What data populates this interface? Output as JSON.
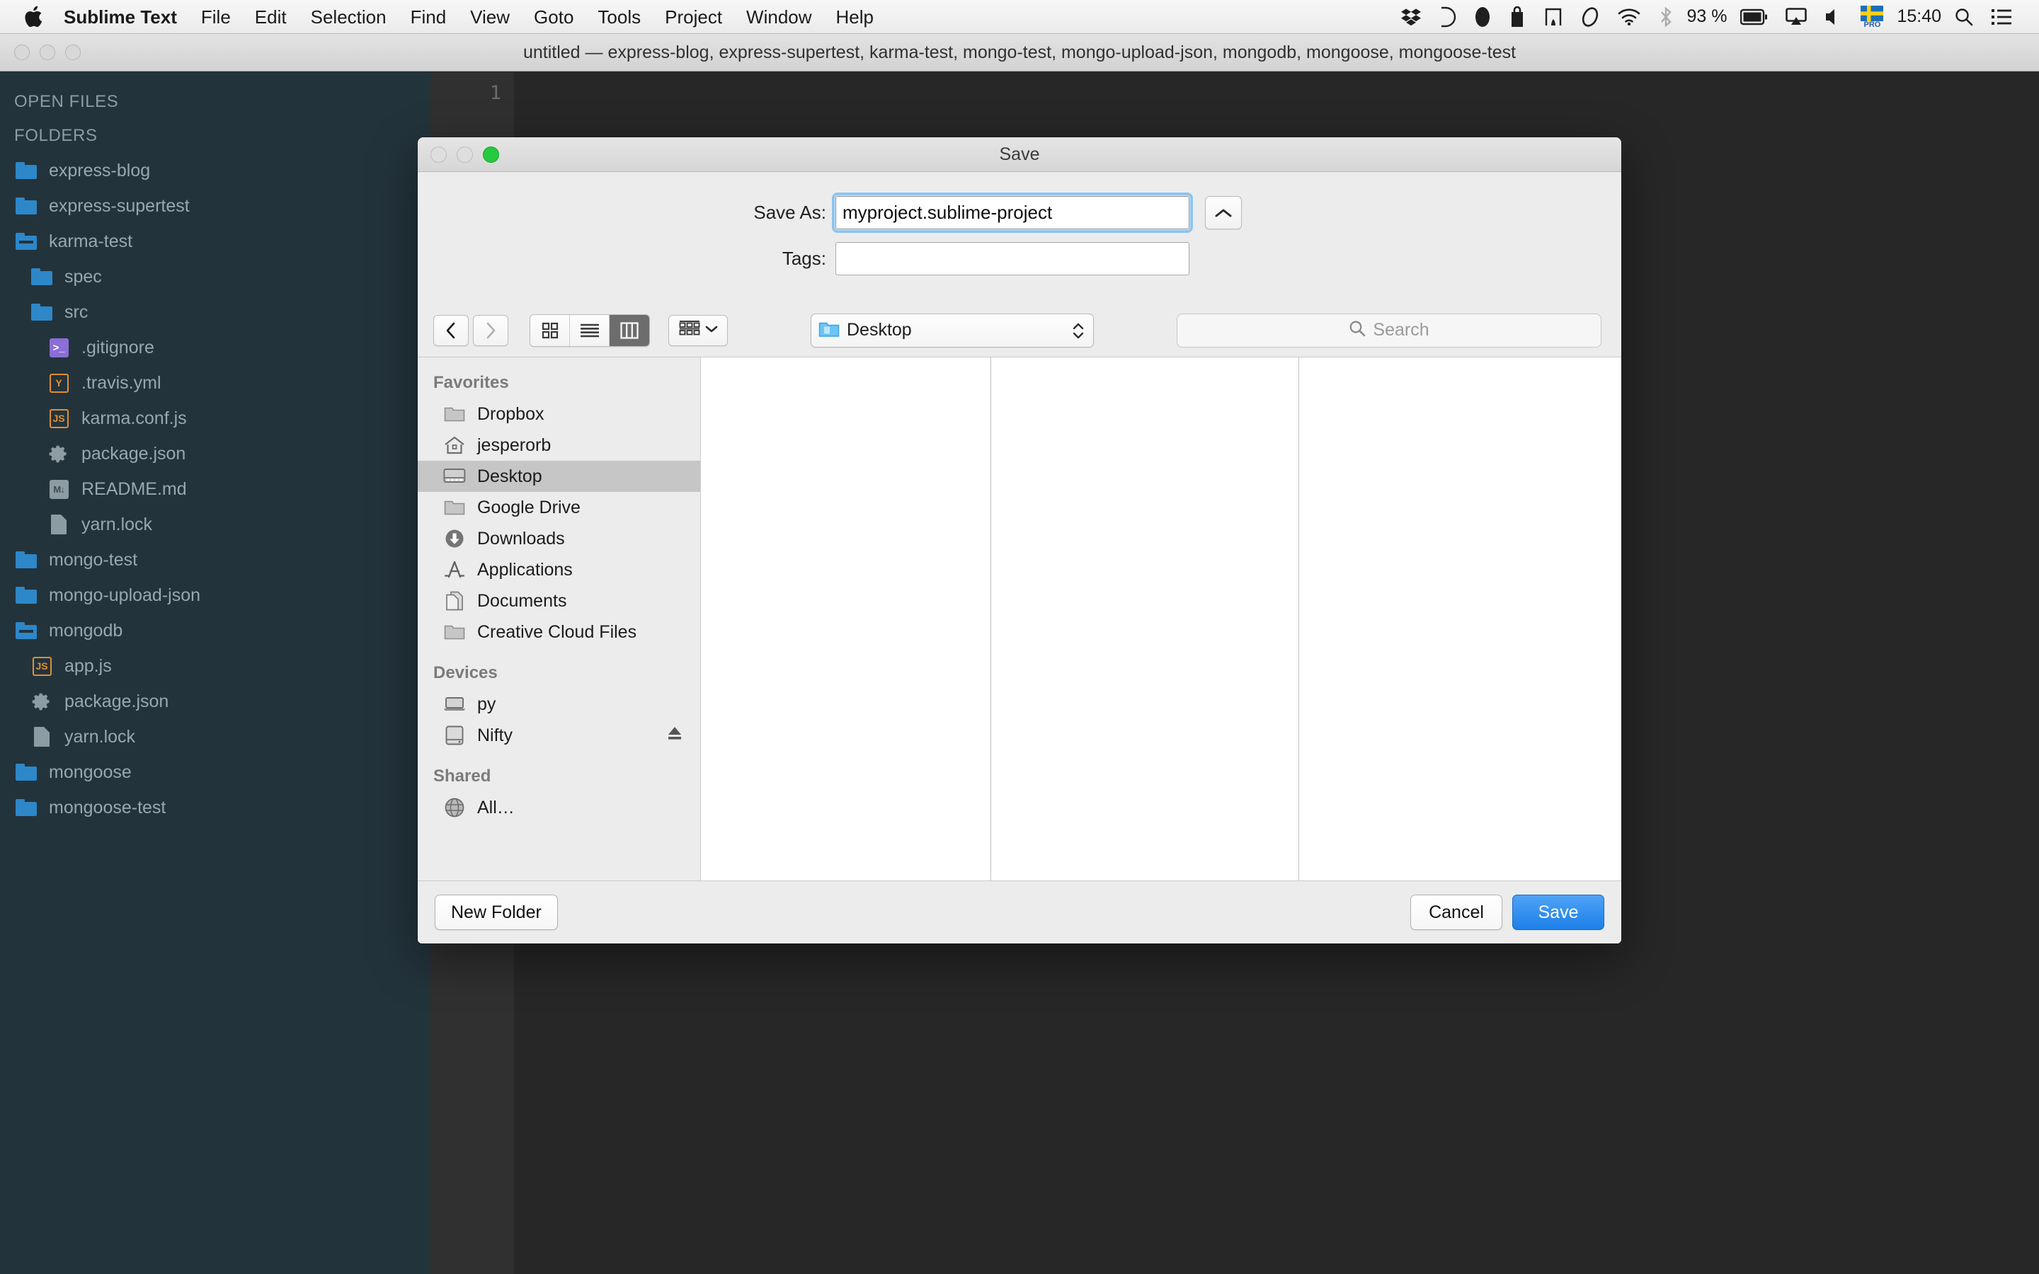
{
  "menubar": {
    "apple_icon": "apple-logo-icon",
    "items": [
      {
        "label": "Sublime Text",
        "bold": true
      },
      {
        "label": "File"
      },
      {
        "label": "Edit"
      },
      {
        "label": "Selection"
      },
      {
        "label": "Find"
      },
      {
        "label": "View"
      },
      {
        "label": "Goto"
      },
      {
        "label": "Tools"
      },
      {
        "label": "Project"
      },
      {
        "label": "Window"
      },
      {
        "label": "Help"
      }
    ],
    "status": {
      "icons": [
        "dropbox-icon",
        "d-app-icon",
        "mouse-icon",
        "backup-icon",
        "app-icon",
        "cloud-icon",
        "wifi-icon",
        "bluetooth-icon"
      ],
      "battery_percent": "93 %",
      "battery_icon": "battery-icon",
      "airplay_icon": "airplay-icon",
      "volume_icon": "volume-icon",
      "input_flag": "swedish-flag-icon",
      "input_flag_label": "PRO",
      "clock": "15:40",
      "spotlight_icon": "search-icon",
      "notification_icon": "notification-center-icon"
    }
  },
  "sublime": {
    "title": "untitled — express-blog, express-supertest, karma-test, mongo-test, mongo-upload-json, mongodb, mongoose, mongoose-test",
    "editor": {
      "line_number": "1"
    },
    "sidebar": {
      "open_files_title": "OPEN FILES",
      "folders_title": "FOLDERS",
      "items": [
        {
          "label": "express-blog",
          "icon": "folder-icon",
          "indent": 0
        },
        {
          "label": "express-supertest",
          "icon": "folder-icon",
          "indent": 0
        },
        {
          "label": "karma-test",
          "icon": "folder-open-icon",
          "indent": 0
        },
        {
          "label": "spec",
          "icon": "folder-icon",
          "indent": 1
        },
        {
          "label": "src",
          "icon": "folder-icon",
          "indent": 1
        },
        {
          "label": ".gitignore",
          "icon": "terminal-file-icon",
          "indent": 1
        },
        {
          "label": ".travis.yml",
          "icon": "yaml-file-icon",
          "indent": 1
        },
        {
          "label": "karma.conf.js",
          "icon": "js-file-icon",
          "indent": 1
        },
        {
          "label": "package.json",
          "icon": "gear-file-icon",
          "indent": 1
        },
        {
          "label": "README.md",
          "icon": "markdown-file-icon",
          "indent": 1
        },
        {
          "label": "yarn.lock",
          "icon": "plain-file-icon",
          "indent": 1
        },
        {
          "label": "mongo-test",
          "icon": "folder-icon",
          "indent": 0
        },
        {
          "label": "mongo-upload-json",
          "icon": "folder-icon",
          "indent": 0
        },
        {
          "label": "mongodb",
          "icon": "folder-open-icon",
          "indent": 0
        },
        {
          "label": "app.js",
          "icon": "js-file-icon",
          "indent": 1
        },
        {
          "label": "package.json",
          "icon": "gear-file-icon",
          "indent": 1
        },
        {
          "label": "yarn.lock",
          "icon": "plain-file-icon",
          "indent": 1
        },
        {
          "label": "mongoose",
          "icon": "folder-icon",
          "indent": 0
        },
        {
          "label": "mongoose-test",
          "icon": "folder-icon",
          "indent": 0
        }
      ]
    }
  },
  "save_dialog": {
    "title": "Save",
    "save_as_label": "Save As:",
    "save_as_value": "myproject.sublime-project",
    "tags_label": "Tags:",
    "tags_value": "",
    "collapse_icon": "chevron-up-icon",
    "toolbar": {
      "back_icon": "chevron-left-icon",
      "forward_icon": "chevron-right-icon",
      "view_icon_grid": "icon-view-icon",
      "view_list": "list-view-icon",
      "view_column": "column-view-icon",
      "active_view": "column-view-icon",
      "arrange_icon": "arrange-by-icon",
      "arrange_chevron": "chevron-down-icon",
      "location_label": "Desktop",
      "location_icon": "folder-icon",
      "search_placeholder": "Search",
      "search_icon": "search-icon"
    },
    "places": [
      {
        "section": "Favorites"
      },
      {
        "label": "Dropbox",
        "icon": "folder-icon"
      },
      {
        "label": "jesperorb",
        "icon": "home-icon"
      },
      {
        "label": "Desktop",
        "icon": "desktop-icon",
        "selected": true
      },
      {
        "label": "Google Drive",
        "icon": "folder-icon"
      },
      {
        "label": "Downloads",
        "icon": "downloads-icon"
      },
      {
        "label": "Applications",
        "icon": "applications-icon"
      },
      {
        "label": "Documents",
        "icon": "documents-icon"
      },
      {
        "label": "Creative Cloud Files",
        "icon": "folder-icon"
      },
      {
        "section": "Devices"
      },
      {
        "label": "py",
        "icon": "laptop-icon"
      },
      {
        "label": "Nifty",
        "icon": "harddisk-icon",
        "eject": true,
        "eject_icon": "eject-icon"
      },
      {
        "section": "Shared"
      },
      {
        "label": "All…",
        "icon": "network-globe-icon"
      }
    ],
    "footer": {
      "new_folder_label": "New Folder",
      "cancel_label": "Cancel",
      "save_label": "Save"
    }
  },
  "colors": {
    "sidebar_bg": "#23333c",
    "editor_bg": "#272727",
    "folder_blue": "#2d87c8",
    "accent_blue": "#1d7fe8",
    "focus_ring": "#8fc4f0",
    "green_dot": "#27c93f"
  }
}
